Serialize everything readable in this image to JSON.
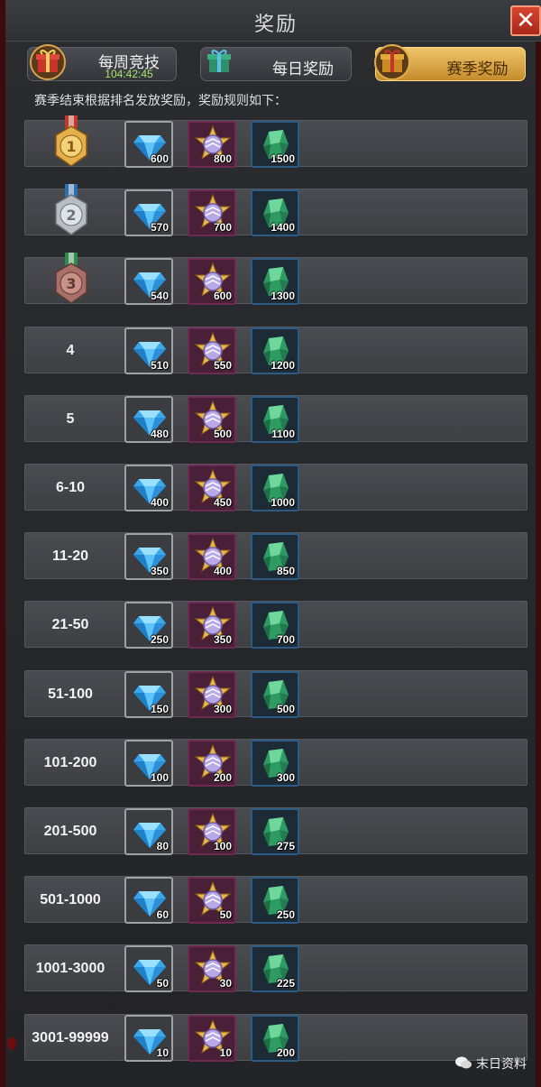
{
  "window": {
    "title": "奖励",
    "close_glyph": "✕"
  },
  "tabs": [
    {
      "label": "每周竞技",
      "timer": "104:42:45",
      "active": false,
      "icon": "gift-red-icon"
    },
    {
      "label": "每日奖励",
      "active": false,
      "icon": "gift-green-icon"
    },
    {
      "label": "赛季奖励",
      "active": true,
      "icon": "gift-gold-icon"
    }
  ],
  "subtitle": "赛季结束根据排名发放奖励，奖励规则如下：",
  "reward_icons": {
    "gem": "blue-diamond-icon",
    "star": "purple-star-badge-icon",
    "ore": "green-crystal-icon"
  },
  "rows": [
    {
      "rank": "1",
      "medal": "gold",
      "gem": "600",
      "star": "800",
      "ore": "1500"
    },
    {
      "rank": "2",
      "medal": "silver",
      "gem": "570",
      "star": "700",
      "ore": "1400"
    },
    {
      "rank": "3",
      "medal": "bronze",
      "gem": "540",
      "star": "600",
      "ore": "1300"
    },
    {
      "rank": "4",
      "gem": "510",
      "star": "550",
      "ore": "1200"
    },
    {
      "rank": "5",
      "gem": "480",
      "star": "500",
      "ore": "1100"
    },
    {
      "rank": "6-10",
      "gem": "400",
      "star": "450",
      "ore": "1000"
    },
    {
      "rank": "11-20",
      "gem": "350",
      "star": "400",
      "ore": "850"
    },
    {
      "rank": "21-50",
      "gem": "250",
      "star": "350",
      "ore": "700"
    },
    {
      "rank": "51-100",
      "gem": "150",
      "star": "300",
      "ore": "500"
    },
    {
      "rank": "101-200",
      "gem": "100",
      "star": "200",
      "ore": "300"
    },
    {
      "rank": "201-500",
      "gem": "80",
      "star": "100",
      "ore": "275"
    },
    {
      "rank": "501-1000",
      "gem": "60",
      "star": "50",
      "ore": "250"
    },
    {
      "rank": "1001-3000",
      "gem": "50",
      "star": "30",
      "ore": "225"
    },
    {
      "rank": "3001-99999",
      "gem": "10",
      "star": "10",
      "ore": "200"
    }
  ],
  "watermark": {
    "text": "末日资料",
    "icon": "wechat-icon"
  },
  "colors": {
    "accent_gold": "#e3ad4a",
    "close_red": "#c2351f",
    "timer_green": "#a6e36a"
  }
}
